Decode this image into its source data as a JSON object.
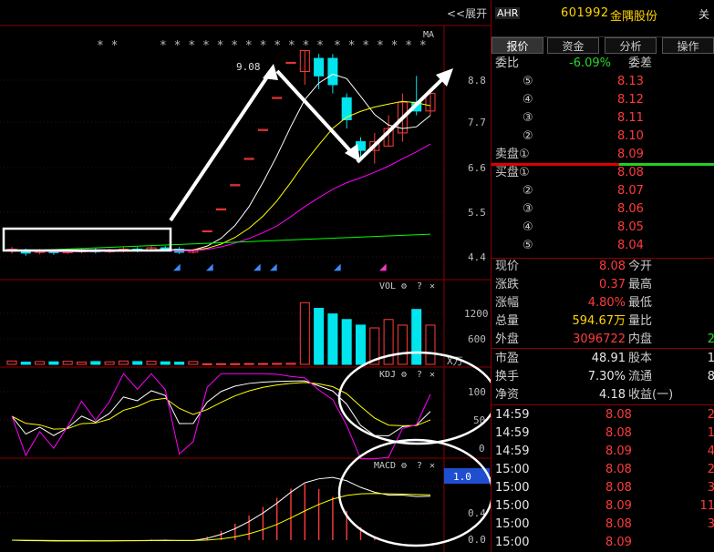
{
  "expand_label": "<<展开",
  "ma_label": "MA",
  "high_marker": "9.08",
  "stars": [
    "* *",
    "* * * * * * * * * * * *",
    "* * * * * * *"
  ],
  "price_axis": [
    "8.8",
    "7.7",
    "6.6",
    "5.5",
    "4.4"
  ],
  "vol_axis": [
    "1200",
    "600"
  ],
  "vol_unit": "X万",
  "kdj_axis": [
    "100",
    "50",
    "0"
  ],
  "macd_axis": [
    "0.4",
    "0.0"
  ],
  "macd_badge": "1.0",
  "indicators": {
    "vol": "VOL",
    "kdj": "KDJ",
    "macd": "MACD"
  },
  "colors": {
    "up": "#ff3b3b",
    "down": "#00e5ee",
    "ma5": "#ffffff",
    "ma10": "#ffff00",
    "ma20": "#ff00ff",
    "ma60": "#00ff00"
  },
  "header": {
    "tag": "AHR",
    "code": "601992",
    "name": "金隅股份",
    "close": "关"
  },
  "tabs": [
    "报价",
    "资金",
    "分析",
    "操作"
  ],
  "weibi": {
    "label": "委比",
    "value": "-6.09%",
    "label2": "委差"
  },
  "sell_orders": [
    {
      "level": "⑤",
      "price": "8.13"
    },
    {
      "level": "④",
      "price": "8.12"
    },
    {
      "level": "③",
      "price": "8.11"
    },
    {
      "level": "②",
      "price": "8.10"
    },
    {
      "level": "卖盘①",
      "price": "8.09"
    }
  ],
  "buy_orders": [
    {
      "level": "买盘①",
      "price": "8.08"
    },
    {
      "level": "②",
      "price": "8.07"
    },
    {
      "level": "③",
      "price": "8.06"
    },
    {
      "level": "④",
      "price": "8.05"
    },
    {
      "level": "⑤",
      "price": "8.04"
    }
  ],
  "quote": [
    {
      "l": "现价",
      "v": "8.08",
      "c": "red",
      "l2": "今开",
      "v2": ""
    },
    {
      "l": "涨跌",
      "v": "0.37",
      "c": "red",
      "l2": "最高",
      "v2": ""
    },
    {
      "l": "涨幅",
      "v": "4.80%",
      "c": "red",
      "l2": "最低",
      "v2": ""
    },
    {
      "l": "总量",
      "v": "594.67万",
      "c": "yellow",
      "l2": "量比",
      "v2": ""
    },
    {
      "l": "外盘",
      "v": "3096722",
      "c": "red",
      "l2": "内盘",
      "v2": "2"
    }
  ],
  "fund": [
    {
      "l": "市盈",
      "v": "48.91",
      "l2": "股本",
      "v2": "1"
    },
    {
      "l": "换手",
      "v": "7.30%",
      "l2": "流通",
      "v2": "8"
    },
    {
      "l": "净资",
      "v": "4.18",
      "l2": "收益(一)",
      "v2": ""
    }
  ],
  "ticks": [
    {
      "t": "14:59",
      "p": "8.08",
      "q": "2"
    },
    {
      "t": "14:59",
      "p": "8.08",
      "q": "1"
    },
    {
      "t": "14:59",
      "p": "8.09",
      "q": "4"
    },
    {
      "t": "15:00",
      "p": "8.08",
      "q": "2"
    },
    {
      "t": "15:00",
      "p": "8.08",
      "q": "3"
    },
    {
      "t": "15:00",
      "p": "8.09",
      "q": "11"
    },
    {
      "t": "15:00",
      "p": "8.08",
      "q": "3"
    },
    {
      "t": "15:00",
      "p": "8.09",
      "q": ""
    }
  ],
  "chart_data": {
    "type": "candlestick",
    "ylim": [
      4.0,
      9.4
    ],
    "candles": [
      [
        4.52,
        4.55,
        4.45,
        4.6
      ],
      [
        4.5,
        4.46,
        4.4,
        4.56
      ],
      [
        4.48,
        4.5,
        4.43,
        4.55
      ],
      [
        4.5,
        4.47,
        4.42,
        4.54
      ],
      [
        4.47,
        4.5,
        4.44,
        4.55
      ],
      [
        4.5,
        4.52,
        4.46,
        4.57
      ],
      [
        4.52,
        4.49,
        4.45,
        4.57
      ],
      [
        4.49,
        4.52,
        4.46,
        4.56
      ],
      [
        4.52,
        4.55,
        4.48,
        4.6
      ],
      [
        4.55,
        4.52,
        4.48,
        4.6
      ],
      [
        4.52,
        4.58,
        4.49,
        4.62
      ],
      [
        4.58,
        4.55,
        4.5,
        4.62
      ],
      [
        4.55,
        4.48,
        4.44,
        4.6
      ],
      [
        4.48,
        4.52,
        4.45,
        4.56
      ],
      [
        4.97,
        4.97,
        4.97,
        4.97
      ],
      [
        5.47,
        5.47,
        5.47,
        5.47
      ],
      [
        6.02,
        6.02,
        6.02,
        6.02
      ],
      [
        6.62,
        6.62,
        6.62,
        6.62
      ],
      [
        7.28,
        7.28,
        7.28,
        7.28
      ],
      [
        8.01,
        8.01,
        8.01,
        8.01
      ],
      [
        8.81,
        8.81,
        8.81,
        8.81
      ],
      [
        8.6,
        9.08,
        8.3,
        9.08
      ],
      [
        8.9,
        8.5,
        8.2,
        9.0
      ],
      [
        8.9,
        8.3,
        8.1,
        9.0
      ],
      [
        8.0,
        7.5,
        7.3,
        8.1
      ],
      [
        7.0,
        6.8,
        6.6,
        7.1
      ],
      [
        6.8,
        7.0,
        6.5,
        7.2
      ],
      [
        6.9,
        7.3,
        6.9,
        7.6
      ],
      [
        7.2,
        7.9,
        7.0,
        8.1
      ],
      [
        7.9,
        7.7,
        7.6,
        8.5
      ],
      [
        7.7,
        8.1,
        7.6,
        8.2
      ]
    ],
    "volume": [
      60,
      40,
      50,
      45,
      55,
      40,
      50,
      45,
      60,
      50,
      55,
      45,
      40,
      50,
      10,
      12,
      12,
      15,
      15,
      18,
      20,
      1100,
      1000,
      900,
      800,
      700,
      650,
      800,
      700,
      980,
      700
    ],
    "ma_lines": [
      "ma5",
      "ma10",
      "ma20",
      "ma60"
    ]
  }
}
